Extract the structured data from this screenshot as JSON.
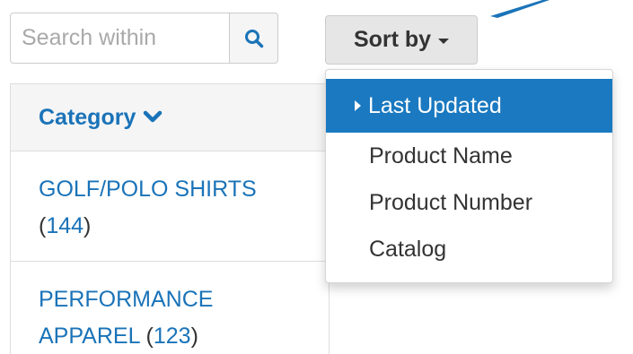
{
  "search": {
    "placeholder": "Search within",
    "value": "",
    "icon": "search-icon"
  },
  "sort": {
    "label": "Sort by",
    "options": [
      {
        "label": "Last Updated",
        "selected": true
      },
      {
        "label": "Product Name",
        "selected": false
      },
      {
        "label": "Product Number",
        "selected": false
      },
      {
        "label": "Catalog",
        "selected": false
      }
    ]
  },
  "category": {
    "header": "Category",
    "items": [
      {
        "name": "GOLF/POLO SHIRTS",
        "count": "144"
      },
      {
        "name": "PERFORMANCE APPAREL",
        "count": "123"
      }
    ]
  },
  "colors": {
    "link": "#1a73b8",
    "active": "#1a79c0"
  }
}
